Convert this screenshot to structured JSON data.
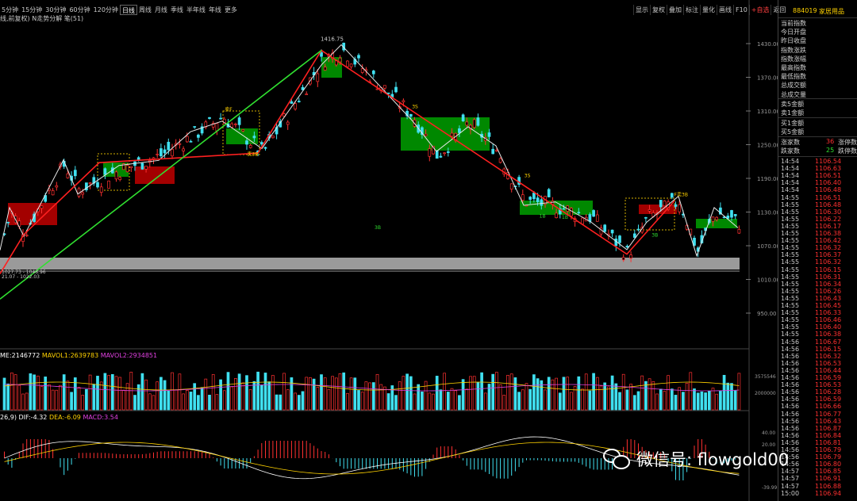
{
  "toolbar": {
    "periods": [
      "5分钟",
      "15分钟",
      "30分钟",
      "60分钟",
      "120分钟",
      "日线",
      "周线",
      "月线",
      "季线",
      "半年线",
      "年线",
      "更多"
    ],
    "active": "日线"
  },
  "right_tools": [
    "显示",
    "复权",
    "叠加",
    "标注",
    "量化",
    "画线",
    "F10",
    "+自选",
    "返回"
  ],
  "indicator_label": "线,前复权) N走势分解 笔(51)",
  "volume_label": {
    "vol": "ME:2146772",
    "mavol1": "MAVOL1:2639783",
    "mavol2": "MAVOL2:2934851"
  },
  "macd_label": {
    "params": "26,9)",
    "dif": "DIF:-4.32",
    "dea": "DEA:-6.09",
    "macd": "MACD:3.54"
  },
  "chart_data": {
    "type": "candlestick",
    "price_axis": {
      "ticks": [
        1430,
        1370,
        1310,
        1250,
        1190,
        1130,
        1070,
        1010,
        950
      ],
      "labels": [
        "1430.00",
        "1370.00",
        "1310.00",
        "1250.00",
        "1190.00",
        "1130.00",
        "1070.00",
        "1010.00",
        "950.00"
      ]
    },
    "volume_axis": {
      "labels": [
        "3575546",
        "2000000"
      ]
    },
    "macd_axis": {
      "labels": [
        "40.00",
        "20.00",
        "-39.99"
      ]
    },
    "high_label": "1416.75",
    "low_labels": [
      "1027.73 - 1048.96",
      "21.07 - 1022.03"
    ],
    "annotations": [
      {
        "text": "3B",
        "x": 0.5,
        "price": 1100
      },
      {
        "text": "卖F",
        "x": 0.3,
        "price": 1310
      },
      {
        "text": "卖3B",
        "x": 0.33,
        "price": 1230
      },
      {
        "text": "3S",
        "x": 0.55,
        "price": 1315
      },
      {
        "text": "3S",
        "x": 0.7,
        "price": 1192
      },
      {
        "text": "1B",
        "x": 0.72,
        "price": 1120
      },
      {
        "text": "1B",
        "x": 0.75,
        "price": 1118
      },
      {
        "text": "F卖3B",
        "x": 0.9,
        "price": 1158
      },
      {
        "text": "3B",
        "x": 0.87,
        "price": 1086
      }
    ],
    "colors": {
      "up": "#ff3030",
      "down": "#40e0f0",
      "pen_red": "#ff2020",
      "pen_green": "#30e030",
      "box_green": "#00a000",
      "box_red": "#c00000"
    }
  },
  "panel": {
    "code": "884019",
    "name": "家居用品",
    "labels": [
      "当前指数",
      "今日开盘",
      "昨日收盘",
      "指数涨跌",
      "指数涨幅",
      "最高指数",
      "最低指数",
      "总成交额",
      "总成交量"
    ],
    "labels2": [
      "卖5金额",
      "卖1金额"
    ],
    "labels3": [
      "买1金额",
      "买5金额"
    ],
    "rise_label": "涨家数",
    "rise_count": "36",
    "rise_tail": "涨停数",
    "fall_label": "跌家数",
    "fall_count": "25",
    "fall_tail": "跌停数",
    "ticks": [
      [
        "14:54",
        "1106.54"
      ],
      [
        "14:54",
        "1106.63"
      ],
      [
        "14:54",
        "1106.51"
      ],
      [
        "14:54",
        "1106.40"
      ],
      [
        "14:54",
        "1106.48"
      ],
      [
        "14:55",
        "1106.51"
      ],
      [
        "14:55",
        "1106.48"
      ],
      [
        "14:55",
        "1106.30"
      ],
      [
        "14:55",
        "1106.22"
      ],
      [
        "14:55",
        "1106.17"
      ],
      [
        "14:55",
        "1106.38"
      ],
      [
        "14:55",
        "1106.42"
      ],
      [
        "14:55",
        "1106.32"
      ],
      [
        "14:55",
        "1106.37"
      ],
      [
        "14:55",
        "1106.32"
      ],
      [
        "14:55",
        "1106.15"
      ],
      [
        "14:55",
        "1106.31"
      ],
      [
        "14:55",
        "1106.34"
      ],
      [
        "14:55",
        "1106.26"
      ],
      [
        "14:55",
        "1106.43"
      ],
      [
        "14:55",
        "1106.45"
      ],
      [
        "14:55",
        "1106.33"
      ],
      [
        "14:55",
        "1106.46"
      ],
      [
        "14:55",
        "1106.40"
      ],
      [
        "14:55",
        "1106.38"
      ],
      [
        "14:56",
        "1106.67"
      ],
      [
        "14:56",
        "1106.15"
      ],
      [
        "14:56",
        "1106.32"
      ],
      [
        "14:56",
        "1106.53"
      ],
      [
        "14:56",
        "1106.44"
      ],
      [
        "14:56",
        "1106.59"
      ],
      [
        "14:56",
        "1106.53"
      ],
      [
        "14:56",
        "1106.28"
      ],
      [
        "14:56",
        "1106.59"
      ],
      [
        "14:56",
        "1106.66"
      ],
      [
        "14:56",
        "1106.77"
      ],
      [
        "14:56",
        "1106.43"
      ],
      [
        "14:56",
        "1106.87"
      ],
      [
        "14:56",
        "1106.84"
      ],
      [
        "14:56",
        "1106.81"
      ],
      [
        "14:56",
        "1106.79"
      ],
      [
        "14:56",
        "1106.79"
      ],
      [
        "14:56",
        "1106.80"
      ],
      [
        "14:57",
        "1106.85"
      ],
      [
        "14:57",
        "1106.91"
      ],
      [
        "14:57",
        "1106.88"
      ],
      [
        "15:00",
        "1106.94"
      ]
    ]
  },
  "watermark": "微信号: flowgold00"
}
